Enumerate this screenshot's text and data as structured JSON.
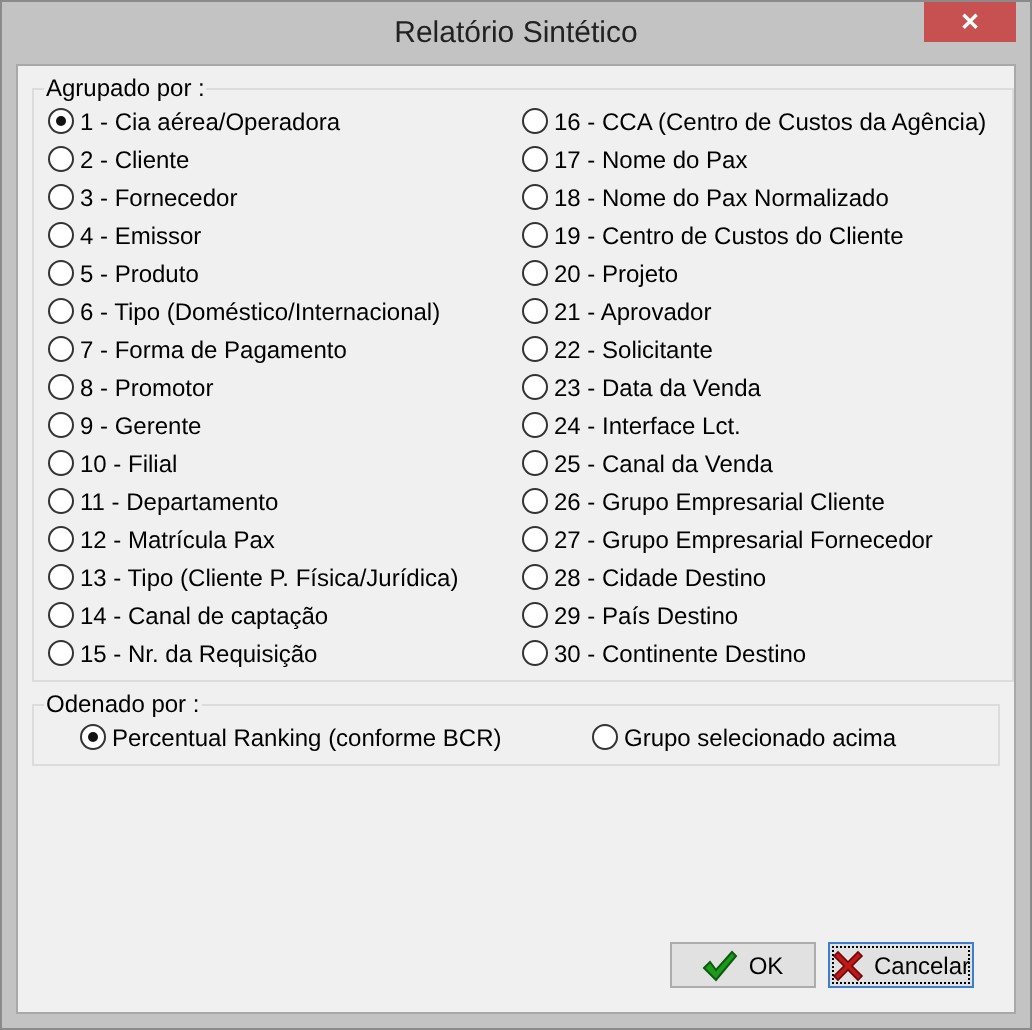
{
  "window": {
    "title": "Relatório Sintético",
    "close": "✕"
  },
  "group_by": {
    "label": "Agrupado por :",
    "options": [
      {
        "label": "1 - Cia aérea/Operadora",
        "selected": true
      },
      {
        "label": "2 - Cliente",
        "selected": false
      },
      {
        "label": "3 - Fornecedor",
        "selected": false
      },
      {
        "label": "4 - Emissor",
        "selected": false
      },
      {
        "label": "5 - Produto",
        "selected": false
      },
      {
        "label": "6 - Tipo (Doméstico/Internacional)",
        "selected": false
      },
      {
        "label": "7 - Forma de Pagamento",
        "selected": false
      },
      {
        "label": "8 - Promotor",
        "selected": false
      },
      {
        "label": "9 - Gerente",
        "selected": false
      },
      {
        "label": "10 - Filial",
        "selected": false
      },
      {
        "label": "11 - Departamento",
        "selected": false
      },
      {
        "label": "12 - Matrícula Pax",
        "selected": false
      },
      {
        "label": "13 - Tipo (Cliente P. Física/Jurídica)",
        "selected": false
      },
      {
        "label": "14 - Canal de captação",
        "selected": false
      },
      {
        "label": "15 - Nr. da Requisição",
        "selected": false
      },
      {
        "label": "16 - CCA (Centro de Custos da Agência)",
        "selected": false
      },
      {
        "label": "17 - Nome do Pax",
        "selected": false
      },
      {
        "label": "18 - Nome do Pax Normalizado",
        "selected": false
      },
      {
        "label": "19 - Centro de Custos do Cliente",
        "selected": false
      },
      {
        "label": "20 - Projeto",
        "selected": false
      },
      {
        "label": "21 - Aprovador",
        "selected": false
      },
      {
        "label": "22 - Solicitante",
        "selected": false
      },
      {
        "label": "23 - Data da Venda",
        "selected": false
      },
      {
        "label": "24 - Interface Lct.",
        "selected": false
      },
      {
        "label": "25 - Canal da Venda",
        "selected": false
      },
      {
        "label": "26 - Grupo Empresarial Cliente",
        "selected": false
      },
      {
        "label": "27 - Grupo Empresarial Fornecedor",
        "selected": false
      },
      {
        "label": "28 - Cidade Destino",
        "selected": false
      },
      {
        "label": "29 - País Destino",
        "selected": false
      },
      {
        "label": "30 - Continente Destino",
        "selected": false
      }
    ]
  },
  "order_by": {
    "label": "Odenado por :",
    "options": [
      {
        "label": "Percentual Ranking (conforme BCR)",
        "selected": true
      },
      {
        "label": "Grupo selecionado acima",
        "selected": false
      }
    ]
  },
  "buttons": [
    {
      "kind": "ok",
      "label": "OK",
      "focused": false
    },
    {
      "kind": "cancel",
      "label": "Cancelar",
      "focused": true
    }
  ]
}
